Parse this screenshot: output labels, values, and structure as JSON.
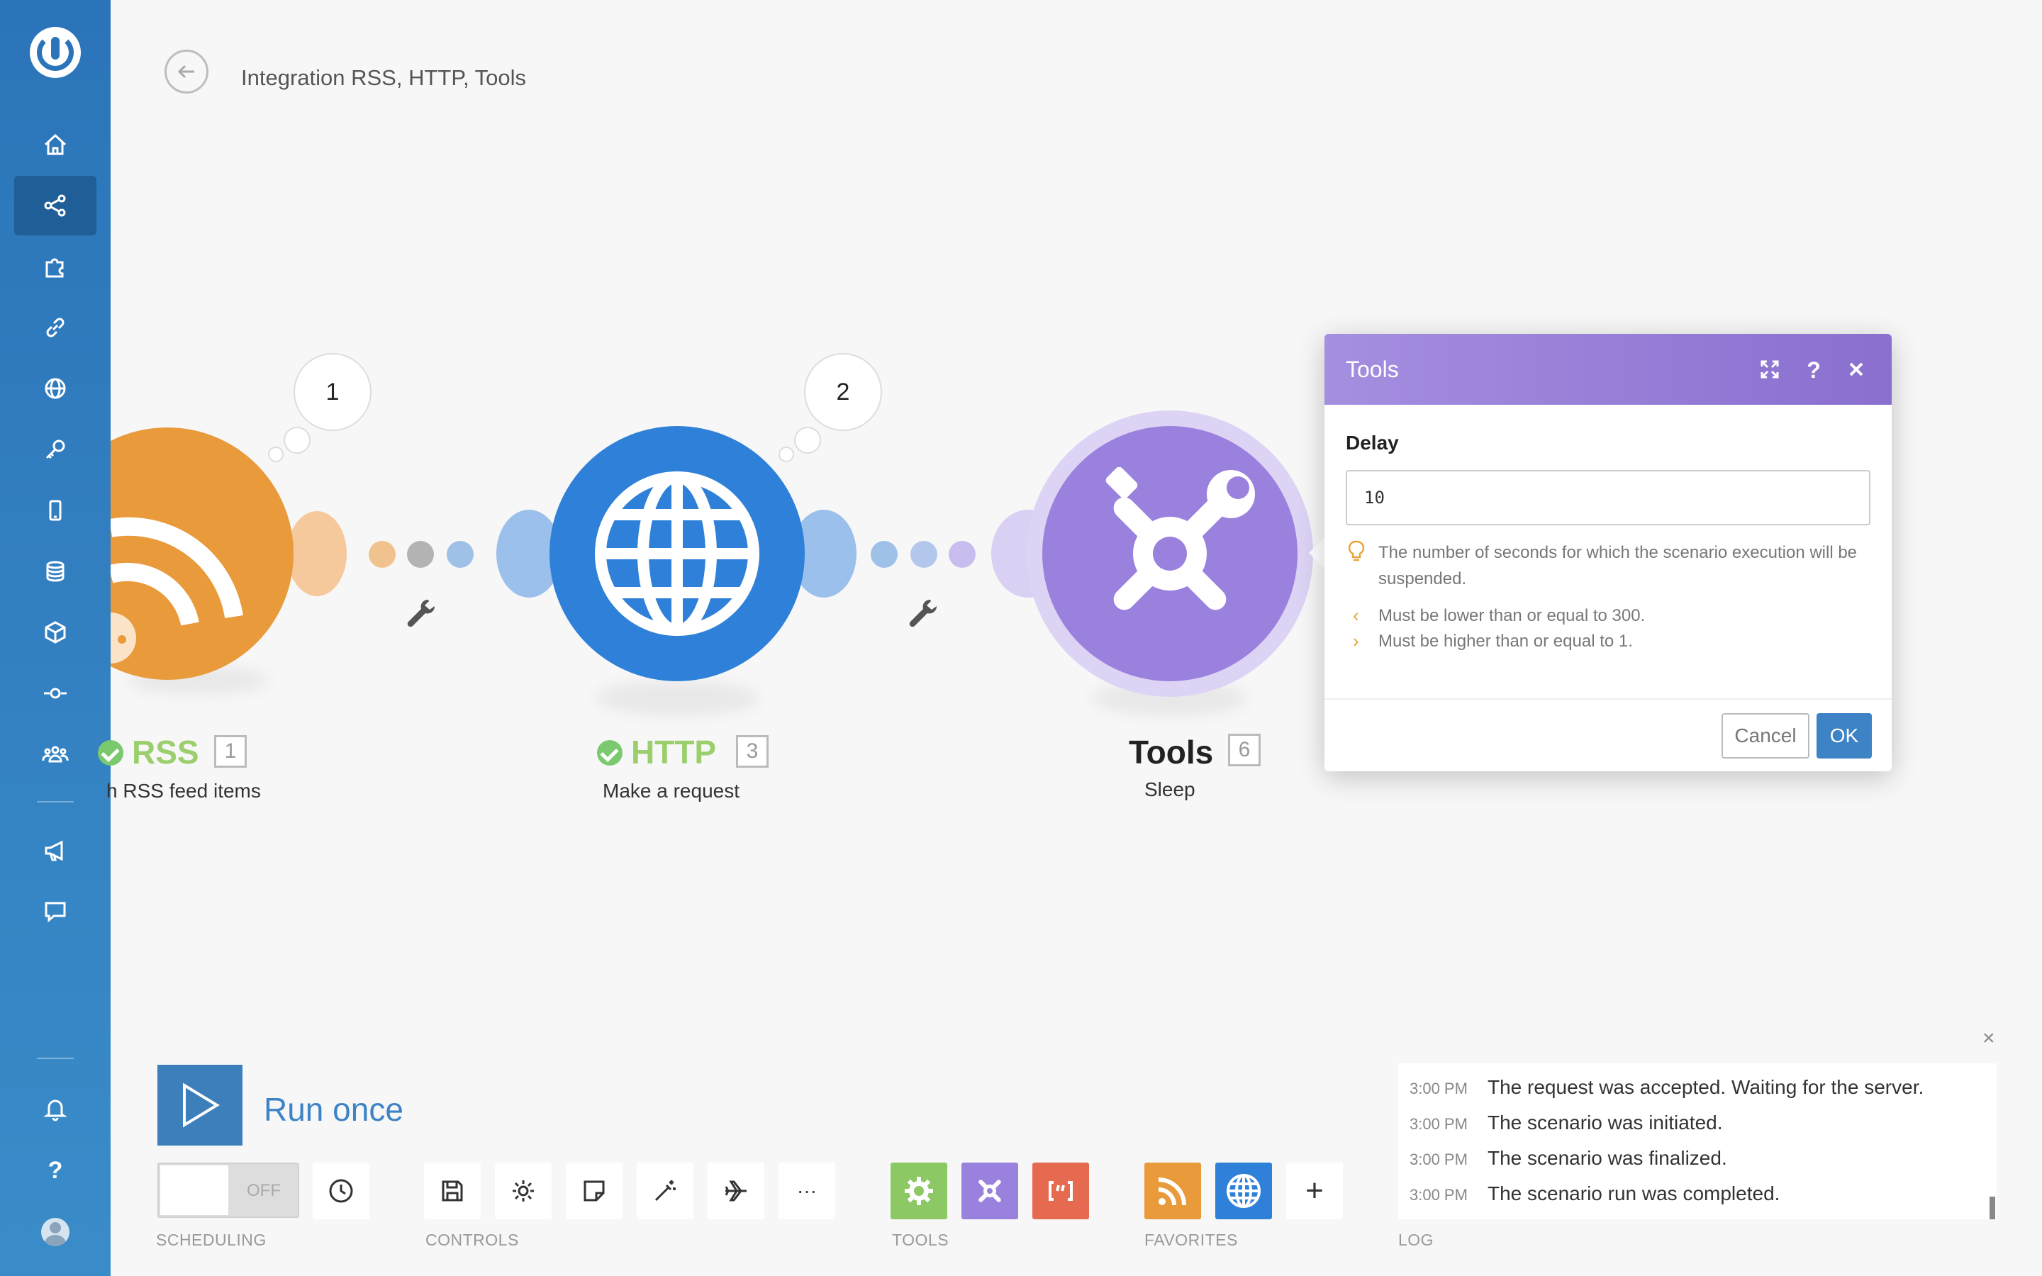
{
  "header": {
    "title": "Integration RSS, HTTP, Tools"
  },
  "canvas": {
    "modules": [
      {
        "name": "RSS",
        "id": "1",
        "subtitle": "h RSS feed items",
        "color": "#e99a3b",
        "status": "success"
      },
      {
        "name": "HTTP",
        "id": "3",
        "subtitle": "Make a request",
        "color": "#2f80d8",
        "status": "success"
      },
      {
        "name": "Tools",
        "id": "6",
        "subtitle": "Sleep",
        "color": "#9b81de"
      }
    ],
    "bubbles": [
      "1",
      "2"
    ]
  },
  "dialog": {
    "title": "Tools",
    "field_label": "Delay",
    "field_value": "10",
    "hint": "The number of seconds for which the scenario execution will be suspended.",
    "rules": [
      "Must be lower than or equal to 300.",
      "Must be higher than or equal to 1."
    ],
    "cancel_label": "Cancel",
    "ok_label": "OK"
  },
  "toolbar": {
    "run_label": "Run once",
    "toggle_label": "OFF",
    "sections": {
      "scheduling": "SCHEDULING",
      "controls": "CONTROLS",
      "tools": "TOOLS",
      "favorites": "FAVORITES",
      "log": "LOG"
    },
    "add_symbol": "+",
    "more_symbol": "···"
  },
  "log": {
    "entries": [
      {
        "time": "3:00 PM",
        "message": "The request was accepted. Waiting for the server."
      },
      {
        "time": "3:00 PM",
        "message": "The scenario was initiated."
      },
      {
        "time": "3:00 PM",
        "message": "The scenario was finalized."
      },
      {
        "time": "3:00 PM",
        "message": "The scenario run was completed."
      }
    ]
  },
  "colors": {
    "sidebar": "#2b74b9",
    "accent": "#3d83c6",
    "tools_purple": "#9b81de",
    "rss_orange": "#e99a3b",
    "http_blue": "#2f80d8",
    "success_green": "#7bc96f"
  }
}
